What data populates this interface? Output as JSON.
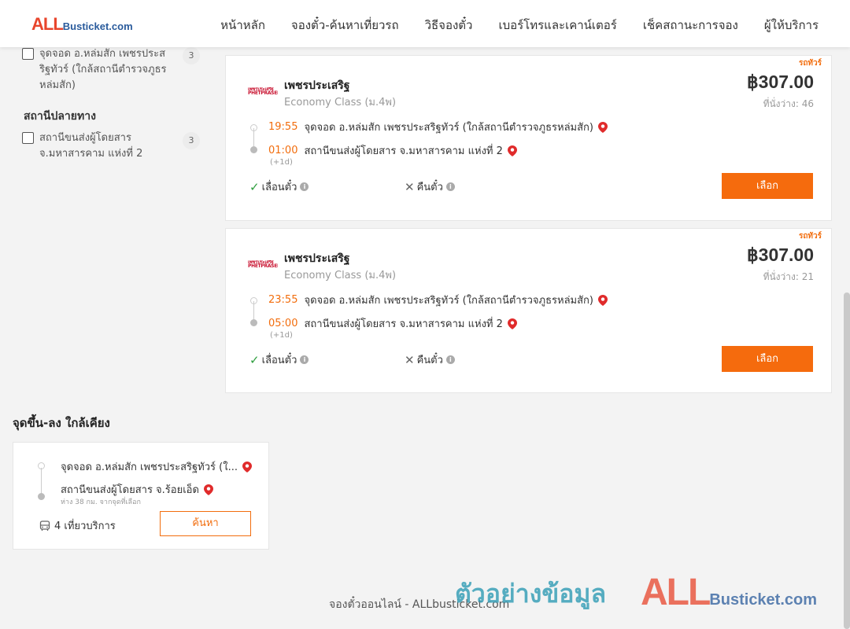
{
  "header": {
    "logo_all": "ALL",
    "logo_rest": "Busticket.com",
    "nav": [
      "หน้าหลัก",
      "จองตั๋ว-ค้นหาเที่ยวรถ",
      "วิธีจองตั๋ว",
      "เบอร์โทรและเคาน์เตอร์",
      "เช็คสถานะการจอง",
      "ผู้ให้บริการ"
    ]
  },
  "filters": {
    "origin_item": {
      "label": "จุดจอด อ.หล่มสัก เพชรประสริฐทัวร์ (ใกล้สถานีตำรวจภูธรหล่มสัก)",
      "count": "3"
    },
    "destination_heading": "สถานีปลายทาง",
    "destination_item": {
      "label": "สถานีขนส่งผู้โดยสาร จ.มหาสารคาม แห่งที่ 2",
      "count": "3"
    }
  },
  "trips": [
    {
      "badge": "รถทัวร์",
      "operator_logo": "เพชรประเสริฐ PHETPRASERT",
      "operator": "เพชรประเสริฐ",
      "bus_class": "Economy Class (ม.4พ)",
      "price": "฿307.00",
      "seats": "ที่นั่งว่าง: 46",
      "depart_time": "19:55",
      "depart_stop": "จุดจอด อ.หล่มสัก เพชรประสริฐทัวร์ (ใกล้สถานีตำรวจภูธรหล่มสัก)",
      "arrive_time": "01:00",
      "arrive_stop": "สถานีขนส่งผู้โดยสาร จ.มหาสารคาม แห่งที่ 2",
      "plus_day": "(+1d)",
      "feature_change": "เลื่อนตั๋ว",
      "feature_refund": "คืนตั๋ว",
      "select_label": "เลือก"
    },
    {
      "badge": "รถทัวร์",
      "operator_logo": "เพชรประเสริฐ PHETPRASERT",
      "operator": "เพชรประเสริฐ",
      "bus_class": "Economy Class (ม.4พ)",
      "price": "฿307.00",
      "seats": "ที่นั่งว่าง: 21",
      "depart_time": "23:55",
      "depart_stop": "จุดจอด อ.หล่มสัก เพชรประสริฐทัวร์ (ใกล้สถานีตำรวจภูธรหล่มสัก)",
      "arrive_time": "05:00",
      "arrive_stop": "สถานีขนส่งผู้โดยสาร จ.มหาสารคาม แห่งที่ 2",
      "plus_day": "(+1d)",
      "feature_change": "เลื่อนตั๋ว",
      "feature_refund": "คืนตั๋ว",
      "select_label": "เลือก"
    }
  ],
  "nearby": {
    "title": "จุดขึ้น-ลง ใกล้เคียง",
    "from": "จุดจอด อ.หล่มสัก เพชรประสริฐทัวร์ (ใ...",
    "to": "สถานีขนส่งผู้โดยสาร จ.ร้อยเอ็ด",
    "distance": "ห่าง 38 กม. จากจุดที่เลือก",
    "trips": "4 เที่ยวบริการ",
    "search_label": "ค้นหา"
  },
  "footer": {
    "text": "จองตั๋วออนไลน์ - ALLbusticket.com",
    "watermark": "ตัวอย่างข้อมูล",
    "watermark_logo_all": "ALL",
    "watermark_logo_rest": "Busticket.com"
  },
  "colors": {
    "accent": "#f56b0d",
    "pin": "#e02b2b",
    "logo_red": "#e8452c",
    "logo_blue": "#2a5b9c"
  },
  "icons": {
    "pin": "map-pin-icon",
    "check": "check-icon",
    "cross": "cross-icon",
    "info": "info-icon",
    "bus": "bus-icon"
  }
}
